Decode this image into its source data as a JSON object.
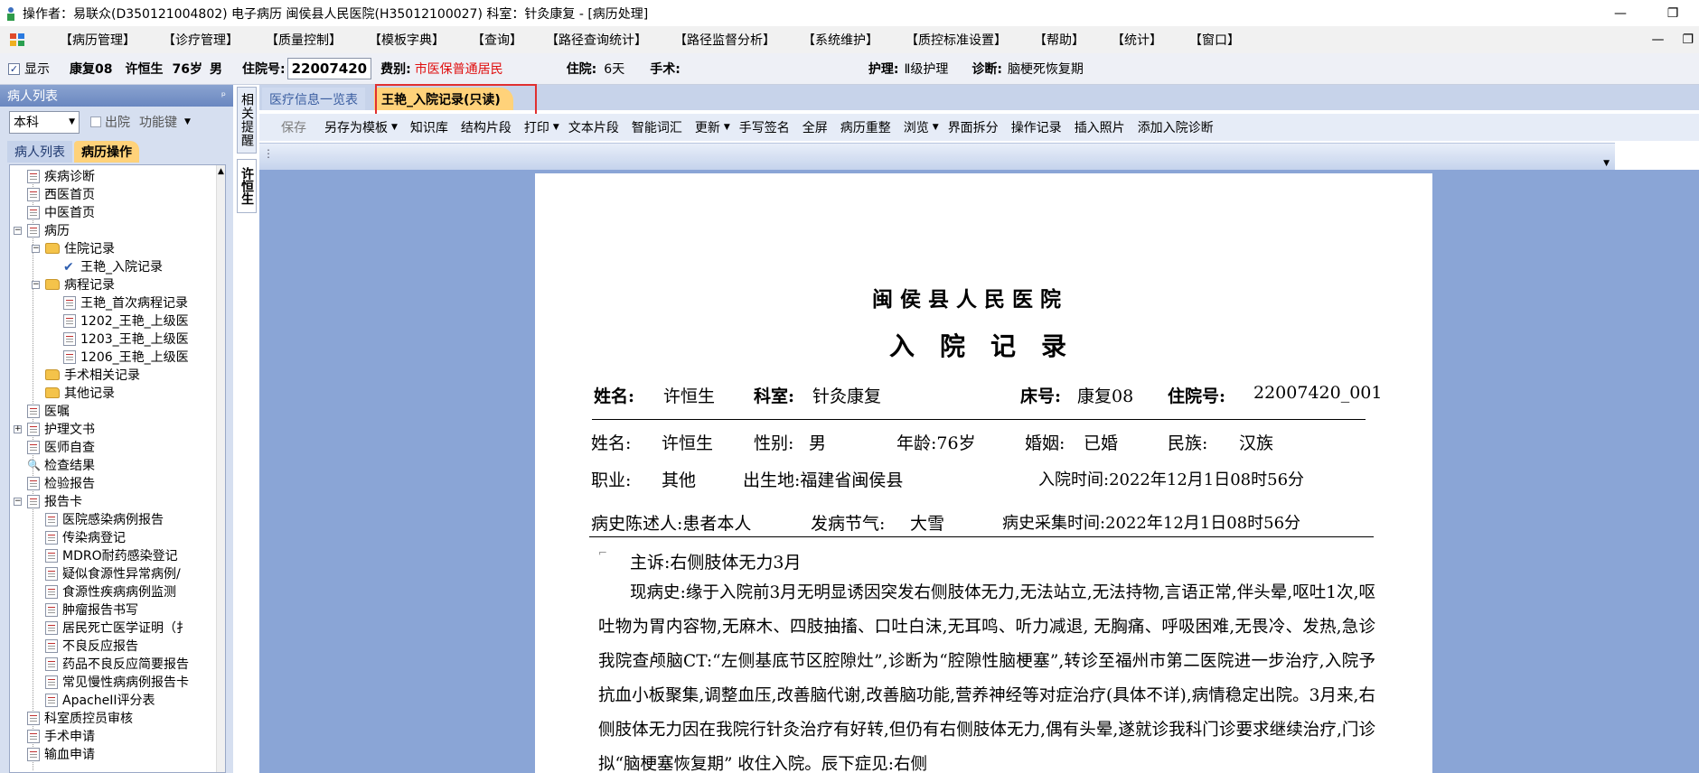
{
  "window": {
    "title": "操作者：易联众(D350121004802) 电子病历  闽侯县人民医院(H35012100027)  科室：针灸康复 - [病历处理]",
    "minimize": "—",
    "restore": "❐"
  },
  "menu": {
    "items": [
      "【病历管理】",
      "【诊疗管理】",
      "【质量控制】",
      "【模板字典】",
      "【查询】",
      "【路径查询统计】",
      "【路径监督分析】",
      "【系统维护】",
      "【质控标准设置】",
      "【帮助】",
      "【统计】",
      "【窗口】"
    ],
    "right": [
      "—",
      "❐"
    ]
  },
  "info": {
    "show_label": "显示",
    "bed": "康复08",
    "name": "许恒生",
    "age": "76岁",
    "sex": "男",
    "adm_label": "住院号:",
    "adm_no": "22007420",
    "fee_label": "费别:",
    "fee_value": "市医保普通居民",
    "stay_label": "住院:",
    "stay_value": "6天",
    "surgery_label": "手术:",
    "nursing_label": "护理:",
    "nursing_value": "Ⅱ级护理",
    "diag_label": "诊断:",
    "diag_value": "脑梗死恢复期"
  },
  "left": {
    "header": "病人列表",
    "pin": "ᵖ",
    "dept_select": "本科",
    "discharge": "出院",
    "func_key": "功能键",
    "tabs": [
      "病人列表",
      "病历操作"
    ],
    "tree": [
      {
        "label": "疾病诊断",
        "icon": "doc"
      },
      {
        "label": "西医首页",
        "icon": "doc"
      },
      {
        "label": "中医首页",
        "icon": "doc"
      },
      {
        "label": "病历",
        "icon": "doc"
      },
      {
        "label": "住院记录",
        "icon": "folder"
      },
      {
        "label": "王艳_入院记录",
        "icon": "check"
      },
      {
        "label": "病程记录",
        "icon": "folder"
      },
      {
        "label": "王艳_首次病程记录",
        "icon": "doc"
      },
      {
        "label": "1202_王艳_上级医",
        "icon": "doc"
      },
      {
        "label": "1203_王艳_上级医",
        "icon": "doc"
      },
      {
        "label": "1206_王艳_上级医",
        "icon": "doc"
      },
      {
        "label": "手术相关记录",
        "icon": "folder"
      },
      {
        "label": "其他记录",
        "icon": "folder"
      },
      {
        "label": "医嘱",
        "icon": "doc"
      },
      {
        "label": "护理文书",
        "icon": "doc"
      },
      {
        "label": "医师自查",
        "icon": "doc"
      },
      {
        "label": "检查结果",
        "icon": "search"
      },
      {
        "label": "检验报告",
        "icon": "doc"
      },
      {
        "label": "报告卡",
        "icon": "doc"
      },
      {
        "label": "医院感染病例报告",
        "icon": "doc"
      },
      {
        "label": "传染病登记",
        "icon": "doc"
      },
      {
        "label": "MDRO耐药感染登记",
        "icon": "doc"
      },
      {
        "label": "疑似食源性异常病例/",
        "icon": "doc"
      },
      {
        "label": "食源性疾病病例监测",
        "icon": "doc"
      },
      {
        "label": "肿瘤报告书写",
        "icon": "doc"
      },
      {
        "label": "居民死亡医学证明（扌",
        "icon": "doc"
      },
      {
        "label": "不良反应报告",
        "icon": "doc"
      },
      {
        "label": "药品不良反应简要报告",
        "icon": "doc"
      },
      {
        "label": "常见慢性病病例报告卡",
        "icon": "doc"
      },
      {
        "label": "ApacheII评分表",
        "icon": "doc"
      },
      {
        "label": "科室质控员审核",
        "icon": "doc"
      },
      {
        "label": "手术申请",
        "icon": "doc"
      },
      {
        "label": "输血申请",
        "icon": "doc"
      }
    ]
  },
  "sidetabs": [
    "相关提醒",
    "许恒生"
  ],
  "doctabs": [
    "医疗信息一览表",
    "王艳_入院记录(只读)"
  ],
  "toolbar": {
    "items": [
      "保存",
      "另存为模板",
      "知识库",
      "结构片段",
      "打印",
      "文本片段",
      "智能词汇",
      "更新",
      "手写签名",
      "全屏",
      "病历重整",
      "浏览",
      "界面拆分",
      "操作记录",
      "插入照片",
      "添加入院诊断"
    ]
  },
  "document": {
    "hospital": "闽 侯 县 人 民 医 院",
    "title": "入　院　记　录",
    "h_name_label": "姓名:",
    "h_name": "许恒生",
    "h_dept_label": "科室:",
    "h_dept": "针灸康复",
    "h_bed_label": "床号:",
    "h_bed": "康复08",
    "h_adm_label": "住院号:",
    "h_adm": "22007420_001",
    "r1_name_label": "姓名:",
    "r1_name": "许恒生",
    "r1_sex_label": "性别:",
    "r1_sex": "男",
    "r1_age": "年龄:76岁",
    "r1_marital_label": "婚姻:",
    "r1_marital": "已婚",
    "r1_ethnic_label": "民族:",
    "r1_ethnic": "汉族",
    "r2_job_label": "职业:",
    "r2_job": "其他",
    "r2_birth": "出生地:福建省闽侯县",
    "r2_admit": "入院时间:2022年12月1日08时56分",
    "r3_narrator": "病史陈述人:患者本人",
    "r3_term_label": "发病节气:",
    "r3_term": "大雪",
    "r3_collect": "病史采集时间:2022年12月1日08时56分",
    "complaint": "主诉:右侧肢体无力3月",
    "history": "现病史:缘于入院前3月无明显诱因突发右侧肢体无力,无法站立,无法持物,言语正常,伴头晕,呕吐1次,呕吐物为胃内容物,无麻木、四肢抽搐、口吐白沫,无耳鸣、听力减退, 无胸痛、呼吸困难,无畏冷、发热,急诊我院查颅脑CT:“左侧基底节区腔隙灶”,诊断为“腔隙性脑梗塞”,转诊至福州市第二医院进一步治疗,入院予抗血小板聚集,调整血压,改善脑代谢,改善脑功能,营养神经等对症治疗(具体不详),病情稳定出院。3月来,右侧肢体无力因在我院行针灸治疗有好转,但仍有右侧肢体无力,偶有头晕,遂就诊我科门诊要求继续治疗,门诊拟“脑梗塞恢复期” 收住入院。辰下症见:右侧"
  }
}
